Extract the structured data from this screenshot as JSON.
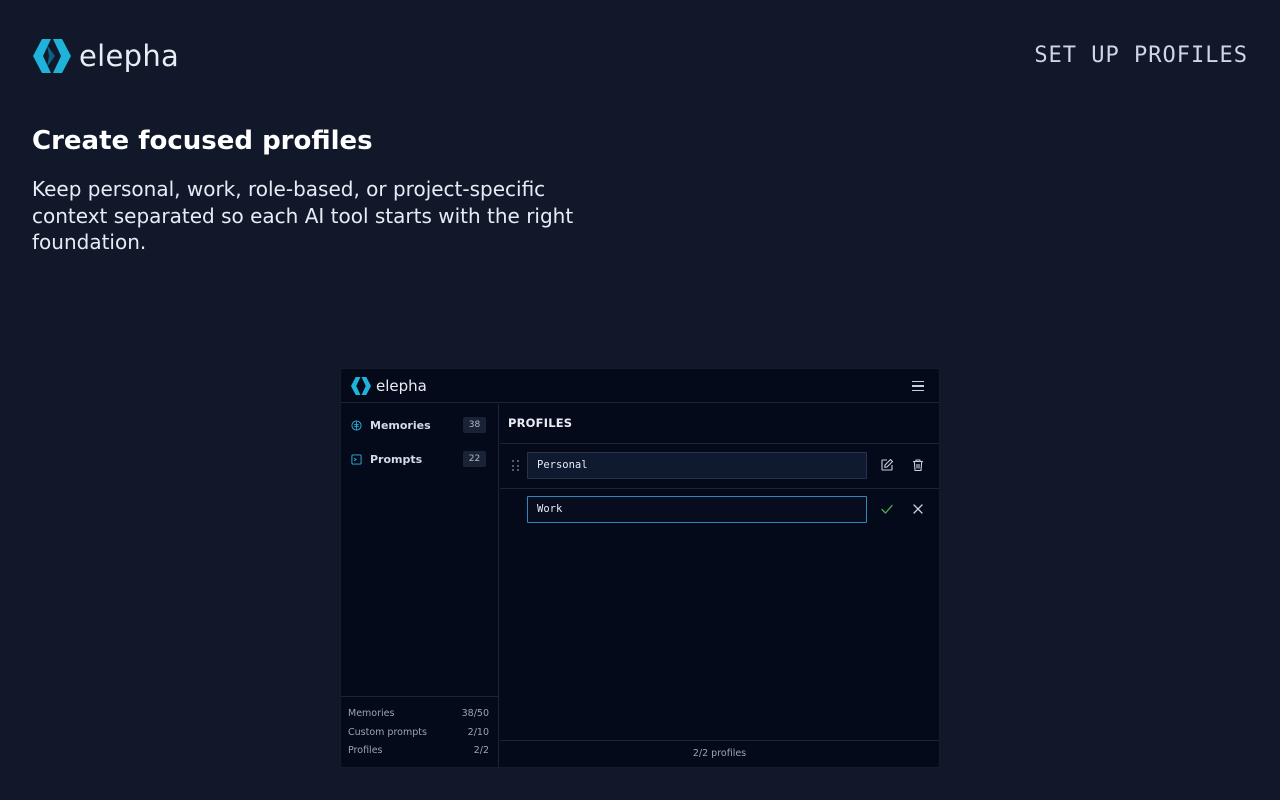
{
  "header": {
    "brand_name": "elepha",
    "step_label": "SET UP PROFILES"
  },
  "hero": {
    "title": "Create focused profiles",
    "description": "Keep personal, work, role-based, or project-specific context separated so each AI tool starts with the right foundation."
  },
  "app": {
    "brand_name": "elepha",
    "menu_icon": "hamburger-menu-icon",
    "sidebar": {
      "items": [
        {
          "label": "Memories",
          "count": "38",
          "icon": "brain-icon"
        },
        {
          "label": "Prompts",
          "count": "22",
          "icon": "prompt-icon"
        }
      ],
      "usage": [
        {
          "label": "Memories",
          "value": "38/50"
        },
        {
          "label": "Custom prompts",
          "value": "2/10"
        },
        {
          "label": "Profiles",
          "value": "2/2"
        }
      ]
    },
    "main": {
      "title": "PROFILES",
      "profiles": [
        {
          "name": "Personal",
          "state": "saved",
          "actions": [
            "edit-icon",
            "trash-icon"
          ]
        },
        {
          "name": "Work",
          "state": "editing",
          "actions": [
            "check-icon",
            "close-icon"
          ]
        }
      ],
      "footer": "2/2 profiles"
    },
    "colors": {
      "accent": "#2bb6e0",
      "background": "#050a1a",
      "confirm": "#4caf50"
    }
  }
}
